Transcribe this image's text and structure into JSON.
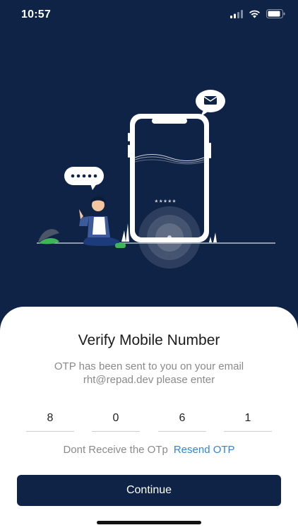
{
  "status_bar": {
    "time": "10:57",
    "icons": [
      "cellular-signal-icon",
      "wifi-icon",
      "battery-icon"
    ]
  },
  "illustration": {
    "icons": [
      "mail-icon",
      "chat-bubble-icon",
      "smartphone-icon",
      "person-icon",
      "leaf-icon"
    ],
    "phone_masked_text": "*****"
  },
  "verify": {
    "title": "Verify Mobile Number",
    "subtitle": "OTP has been sent to you on your email rht@repad.dev please enter",
    "otp_digits": [
      "8",
      "0",
      "6",
      "1"
    ],
    "resend_prompt": "Dont Receive the OTp",
    "resend_link": "Resend OTP",
    "continue_label": "Continue"
  },
  "colors": {
    "background": "#0f2347",
    "button": "#0f2347",
    "link": "#2f86d8",
    "leaf": "#3fb55a"
  }
}
